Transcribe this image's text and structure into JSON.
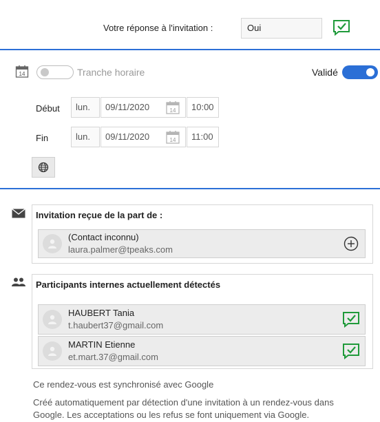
{
  "response": {
    "label": "Votre réponse à l'invitation :",
    "value": "Oui"
  },
  "timeslot": {
    "label": "Tranche horaire",
    "validated_label": "Validé"
  },
  "start": {
    "label": "Début",
    "day": "lun.",
    "date": "09/11/2020",
    "time": "10:00"
  },
  "end": {
    "label": "Fin",
    "day": "lun.",
    "date": "09/11/2020",
    "time": "11:00"
  },
  "invitation": {
    "title": "Invitation reçue de la part de :",
    "name": "(Contact inconnu)",
    "email": "laura.palmer@tpeaks.com"
  },
  "participants": {
    "title": "Participants internes actuellement détectés",
    "items": [
      {
        "name": "HAUBERT Tania",
        "email": "t.haubert37@gmail.com"
      },
      {
        "name": "MARTIN Etienne",
        "email": "et.mart.37@gmail.com"
      }
    ]
  },
  "footer": {
    "sync": "Ce rendez-vous est synchronisé avec Google",
    "info_line1": "Créé automatiquement par détection d'une invitation à un rendez-vous dans",
    "info_line2": "Google. Les acceptations ou les refus se font uniquement via Google."
  },
  "colors": {
    "accent": "#2b6fd6",
    "check": "#1f9a3a"
  },
  "icons": [
    "check-comment-icon",
    "calendar-icon",
    "globe-icon",
    "envelope-icon",
    "people-icon",
    "add-circle-icon",
    "avatar-icon"
  ]
}
